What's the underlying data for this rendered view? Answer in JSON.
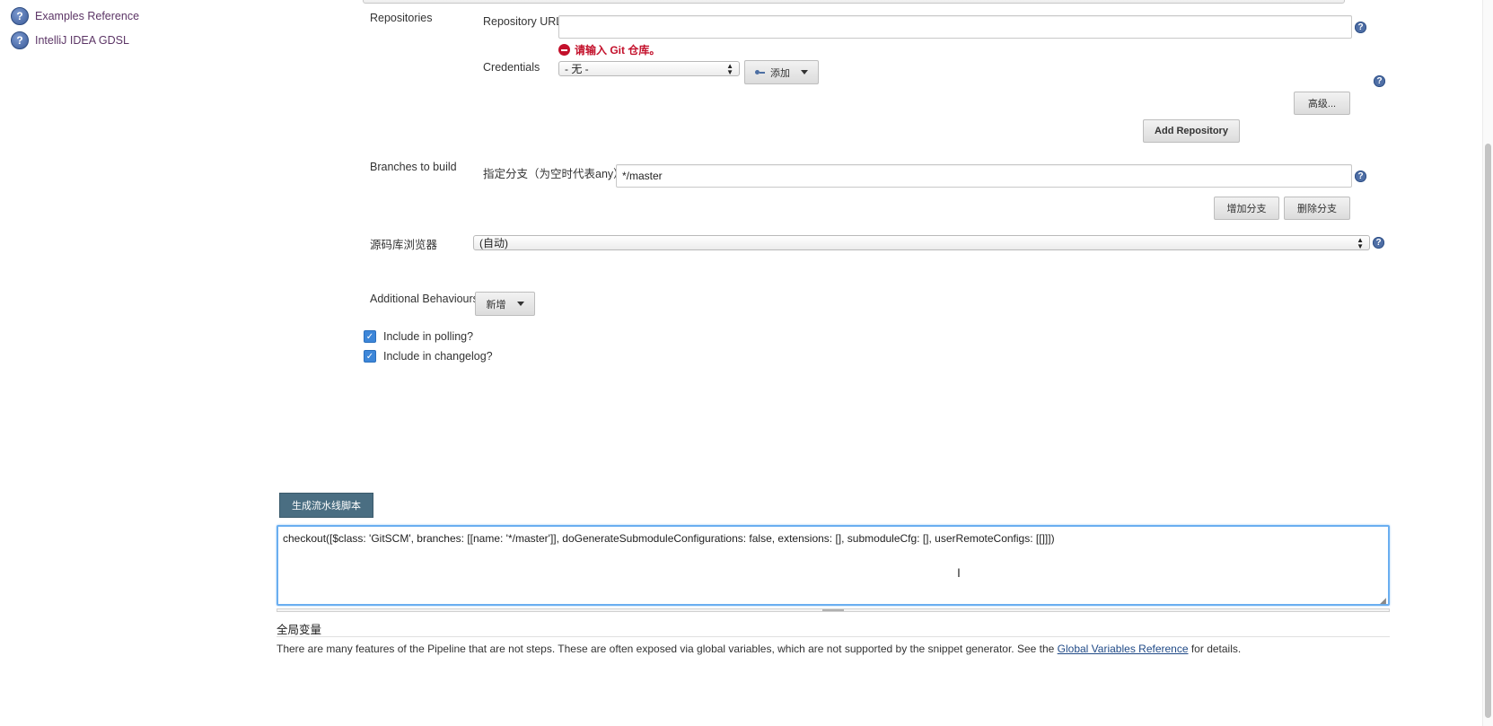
{
  "sidebar": {
    "items": [
      {
        "label": "Examples Reference",
        "icon": "help-icon"
      },
      {
        "label": "IntelliJ IDEA GDSL",
        "icon": "help-icon"
      }
    ]
  },
  "scm": {
    "repositories_label": "Repositories",
    "repo_url_label": "Repository URL",
    "repo_url_value": "",
    "repo_url_error": "请输入 Git 仓库。",
    "credentials_label": "Credentials",
    "credentials_selected": "- 无 -",
    "add_credentials_button": "添加",
    "advanced_button": "高级...",
    "add_repository_button": "Add Repository",
    "branches_label": "Branches to build",
    "branch_specifier_label": "指定分支（为空时代表any）",
    "branch_specifier_value": "*/master",
    "add_branch_button": "增加分支",
    "delete_branch_button": "删除分支",
    "repo_browser_label": "源码库浏览器",
    "repo_browser_selected": "(自动)",
    "additional_behaviours_label": "Additional Behaviours",
    "add_behaviour_button": "新增",
    "include_polling_label": "Include in polling?",
    "include_polling_checked": true,
    "include_changelog_label": "Include in changelog?",
    "include_changelog_checked": true
  },
  "generator": {
    "generate_button": "生成流水线脚本",
    "script_output": "checkout([$class: 'GitSCM', branches: [[name: '*/master']], doGenerateSubmoduleConfigurations: false, extensions: [], submoduleCfg: [], userRemoteConfigs: [[]]])"
  },
  "global_vars": {
    "heading": "全局变量",
    "text_before": "There are many features of the Pipeline that are not steps. These are often exposed via global variables, which are not supported by the snippet generator. See the ",
    "link_text": "Global Variables Reference",
    "text_after": " for details."
  },
  "colors": {
    "link_purple": "#5c3566",
    "generate_button_bg": "#4a6e82",
    "error_red": "#c3102b",
    "focus_blue": "#6aaef0"
  }
}
